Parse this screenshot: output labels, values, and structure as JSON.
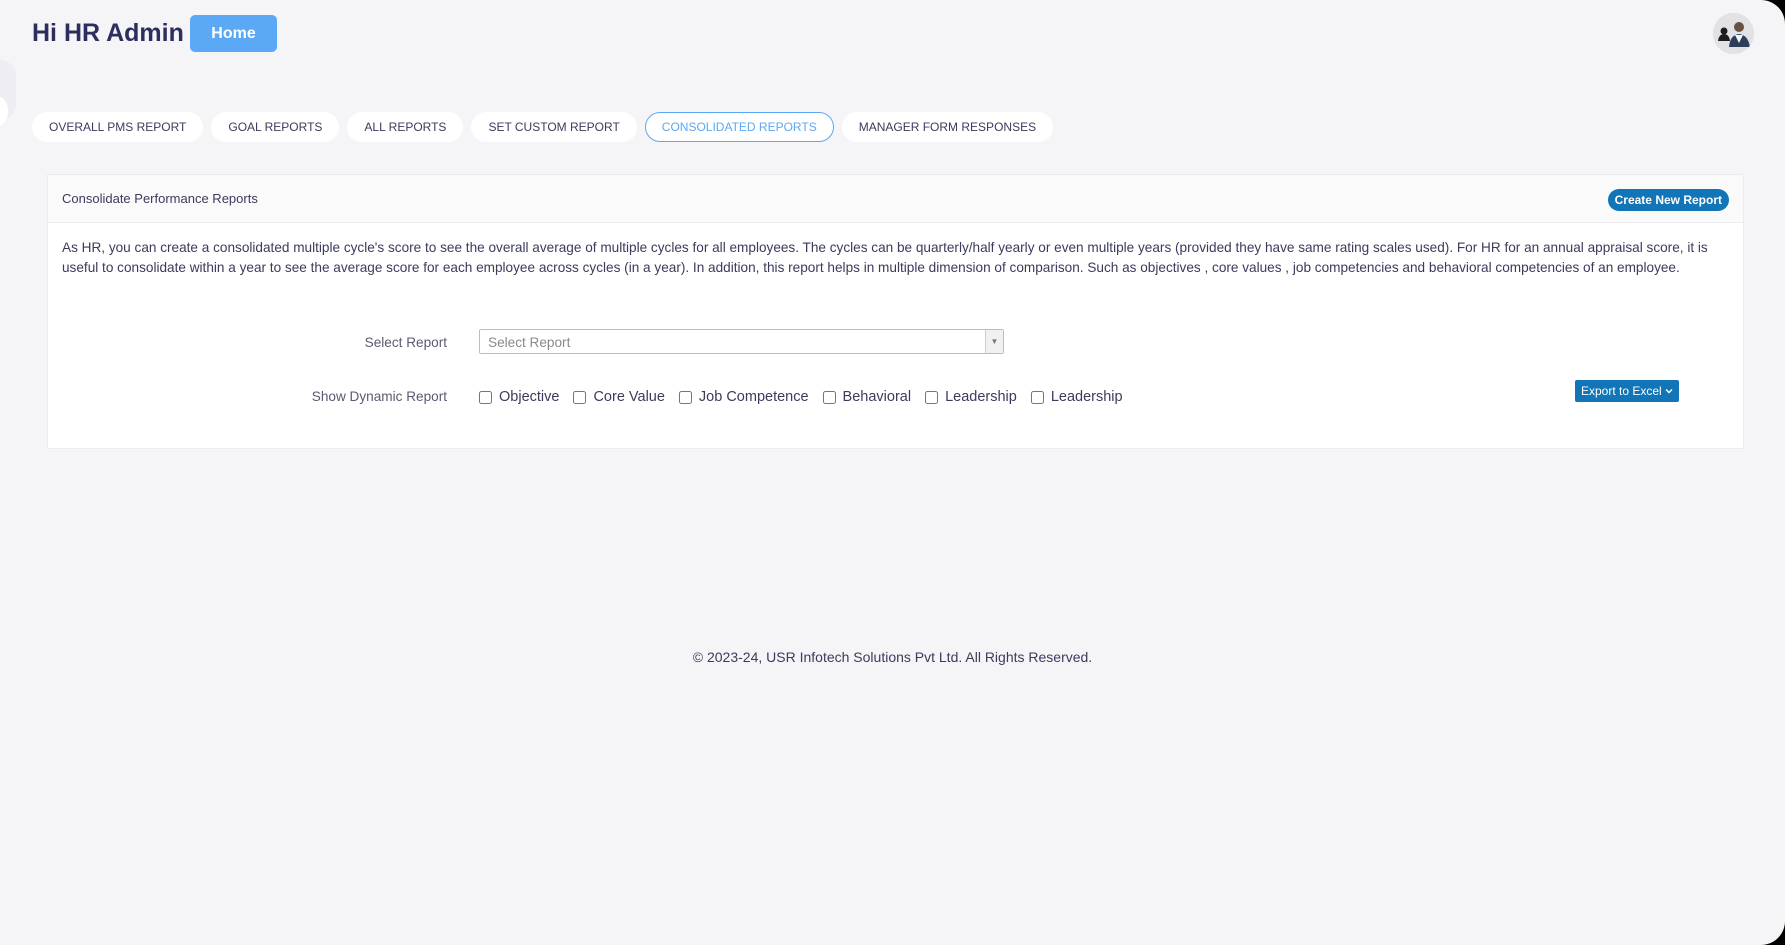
{
  "header": {
    "greeting": "Hi HR Admin",
    "home_label": "Home"
  },
  "tabs": [
    {
      "label": "OVERALL PMS REPORT",
      "active": false
    },
    {
      "label": "GOAL REPORTS",
      "active": false
    },
    {
      "label": "ALL REPORTS",
      "active": false
    },
    {
      "label": "SET CUSTOM REPORT",
      "active": false
    },
    {
      "label": "CONSOLIDATED REPORTS",
      "active": true
    },
    {
      "label": "MANAGER FORM RESPONSES",
      "active": false
    }
  ],
  "card": {
    "title": "Consolidate Performance Reports",
    "create_label": "Create New Report",
    "description": "As HR, you can create a consolidated multiple cycle's score to see the overall average of multiple cycles for all employees. The cycles can be quarterly/half yearly or even multiple years (provided they have same rating scales used). For HR for an annual appraisal score, it is useful to consolidate within a year to see the average score for each employee across cycles (in a year). In addition, this report helps in multiple dimension of comparison. Such as objectives , core values , job competencies and behavioral competencies of an employee.",
    "select_report_label": "Select Report",
    "select_report_placeholder": "Select Report",
    "dynamic_label": "Show Dynamic Report",
    "checkboxes": [
      "Objective",
      "Core Value",
      "Job Competence",
      "Behavioral",
      "Leadership",
      "Leadership"
    ],
    "export_label": "Export to Excel"
  },
  "footer": {
    "text": "© 2023-24, USR Infotech Solutions Pvt Ltd. All Rights Reserved."
  },
  "colors": {
    "accent": "#5ba8f5",
    "primary_button": "#1175b8",
    "text": "#3b3b5c",
    "background": "#f5f5f8"
  },
  "icons": {
    "select_arrow": "triangle-down-icon",
    "export_arrow": "chevron-down-icon",
    "avatar": "user-avatar"
  }
}
